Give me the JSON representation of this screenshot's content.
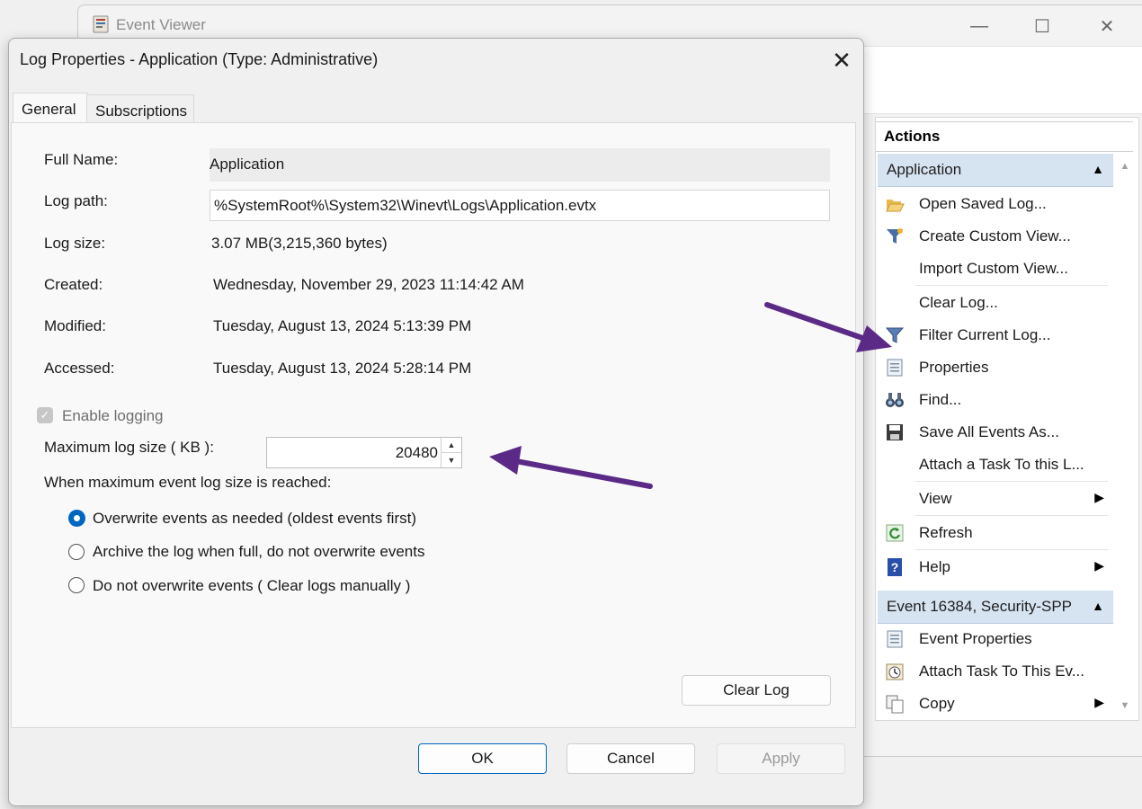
{
  "background_window": {
    "title": "Event Viewer",
    "controls": {
      "minimize": "—",
      "maximize": "☐",
      "close": "✕"
    },
    "actions": {
      "header": "Actions",
      "groups": [
        {
          "label": "Application",
          "items": [
            {
              "label": "Open Saved Log...",
              "icon": "folder-open-icon"
            },
            {
              "label": "Create Custom View...",
              "icon": "filter-funnel-icon"
            },
            {
              "label": "Import Custom View...",
              "icon": ""
            },
            {
              "label": "Clear Log...",
              "icon": ""
            },
            {
              "label": "Filter Current Log...",
              "icon": "filter-icon"
            },
            {
              "label": "Properties",
              "icon": "properties-icon"
            },
            {
              "label": "Find...",
              "icon": "binoculars-icon"
            },
            {
              "label": "Save All Events As...",
              "icon": "save-disk-icon"
            },
            {
              "label": "Attach a Task To this L...",
              "icon": ""
            },
            {
              "label": "View",
              "icon": "",
              "submenu": true
            },
            {
              "label": "Refresh",
              "icon": "refresh-icon"
            },
            {
              "label": "Help",
              "icon": "help-icon",
              "submenu": true
            }
          ]
        },
        {
          "label": "Event 16384, Security-SPP",
          "items": [
            {
              "label": "Event Properties",
              "icon": "properties-icon"
            },
            {
              "label": "Attach Task To This Ev...",
              "icon": "task-clock-icon"
            },
            {
              "label": "Copy",
              "icon": "copy-icon",
              "submenu": true
            }
          ]
        }
      ]
    }
  },
  "dialog": {
    "title": "Log Properties - Application (Type: Administrative)",
    "close_glyph": "✕",
    "tabs": [
      "General",
      "Subscriptions"
    ],
    "fields": {
      "full_name_label": "Full Name:",
      "full_name": "Application",
      "log_path_label": "Log path:",
      "log_path": "%SystemRoot%\\System32\\Winevt\\Logs\\Application.evtx",
      "log_size_label": "Log size:",
      "log_size": "3.07 MB(3,215,360 bytes)",
      "created_label": "Created:",
      "created": "Wednesday, November 29, 2023 11:14:42 AM",
      "modified_label": "Modified:",
      "modified": "Tuesday, August 13, 2024 5:13:39 PM",
      "accessed_label": "Accessed:",
      "accessed": "Tuesday, August 13, 2024 5:28:14 PM"
    },
    "enable_logging": {
      "label": "Enable logging",
      "checked": true,
      "disabled": true
    },
    "max_size": {
      "label": "Maximum log size ( KB ):",
      "value": "20480"
    },
    "when_full_label": "When maximum event log size is reached:",
    "retention_options": [
      {
        "label": "Overwrite events as needed (oldest events first)",
        "selected": true
      },
      {
        "label": "Archive the log when full, do not overwrite events",
        "selected": false
      },
      {
        "label": "Do not overwrite events ( Clear logs manually )",
        "selected": false
      }
    ],
    "buttons": {
      "clear_log": "Clear Log",
      "ok": "OK",
      "cancel": "Cancel",
      "apply": "Apply"
    }
  },
  "colors": {
    "accent": "#0067c0",
    "annotation_arrow": "#5b2a86",
    "group_header_bg": "#d6e3f1"
  }
}
